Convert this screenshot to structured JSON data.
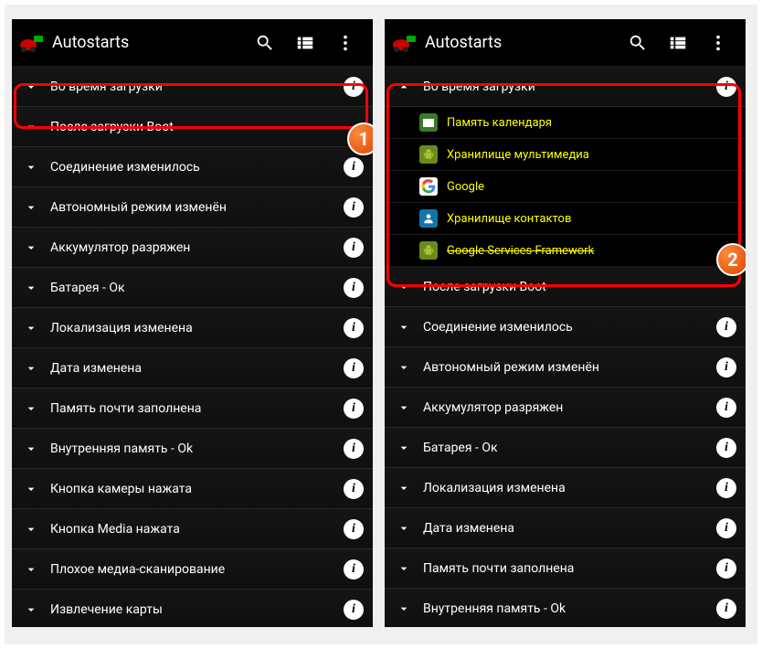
{
  "app": {
    "title": "Autostarts"
  },
  "badges": {
    "one": "1",
    "two": "2"
  },
  "left": {
    "rows": [
      {
        "label": "Во время загрузки",
        "info": true,
        "expanded": false
      },
      {
        "label": "После загрузки Boot",
        "info": false,
        "expanded": false
      },
      {
        "label": "Соединение изменилось",
        "info": true,
        "expanded": false
      },
      {
        "label": "Автономный режим изменён",
        "info": true,
        "expanded": false
      },
      {
        "label": "Аккумулятор разряжен",
        "info": true,
        "expanded": false
      },
      {
        "label": "Батарея - Ок",
        "info": true,
        "expanded": false
      },
      {
        "label": "Локализация изменена",
        "info": true,
        "expanded": false
      },
      {
        "label": "Дата изменена",
        "info": true,
        "expanded": false
      },
      {
        "label": "Память почти заполнена",
        "info": true,
        "expanded": false
      },
      {
        "label": "Внутренняя память - Ok",
        "info": true,
        "expanded": false
      },
      {
        "label": "Кнопка камеры нажата",
        "info": true,
        "expanded": false
      },
      {
        "label": "Кнопка Media нажата",
        "info": true,
        "expanded": false
      },
      {
        "label": "Плохое медиа-сканирование",
        "info": true,
        "expanded": false
      },
      {
        "label": "Извлечение карты",
        "info": true,
        "expanded": false
      }
    ]
  },
  "right": {
    "header": {
      "label": "Во время загрузки",
      "info": true,
      "expanded": true
    },
    "subs": [
      {
        "label": "Память календаря",
        "icon": "cal"
      },
      {
        "label": "Хранилище мультимедиа",
        "icon": "droid"
      },
      {
        "label": "Google",
        "icon": "g"
      },
      {
        "label": "Хранилище контактов",
        "icon": "con"
      },
      {
        "label": "Google Services Framework",
        "icon": "droid",
        "strike": true
      }
    ],
    "rows": [
      {
        "label": "После загрузки Boot",
        "info": false,
        "expanded": false
      },
      {
        "label": "Соединение изменилось",
        "info": true,
        "expanded": false
      },
      {
        "label": "Автономный режим изменён",
        "info": true,
        "expanded": false
      },
      {
        "label": "Аккумулятор разряжен",
        "info": true,
        "expanded": false
      },
      {
        "label": "Батарея - Ок",
        "info": true,
        "expanded": false
      },
      {
        "label": "Локализация изменена",
        "info": true,
        "expanded": false
      },
      {
        "label": "Дата изменена",
        "info": true,
        "expanded": false
      },
      {
        "label": "Память почти заполнена",
        "info": true,
        "expanded": false
      },
      {
        "label": "Внутренняя память - Ok",
        "info": true,
        "expanded": false
      }
    ]
  }
}
